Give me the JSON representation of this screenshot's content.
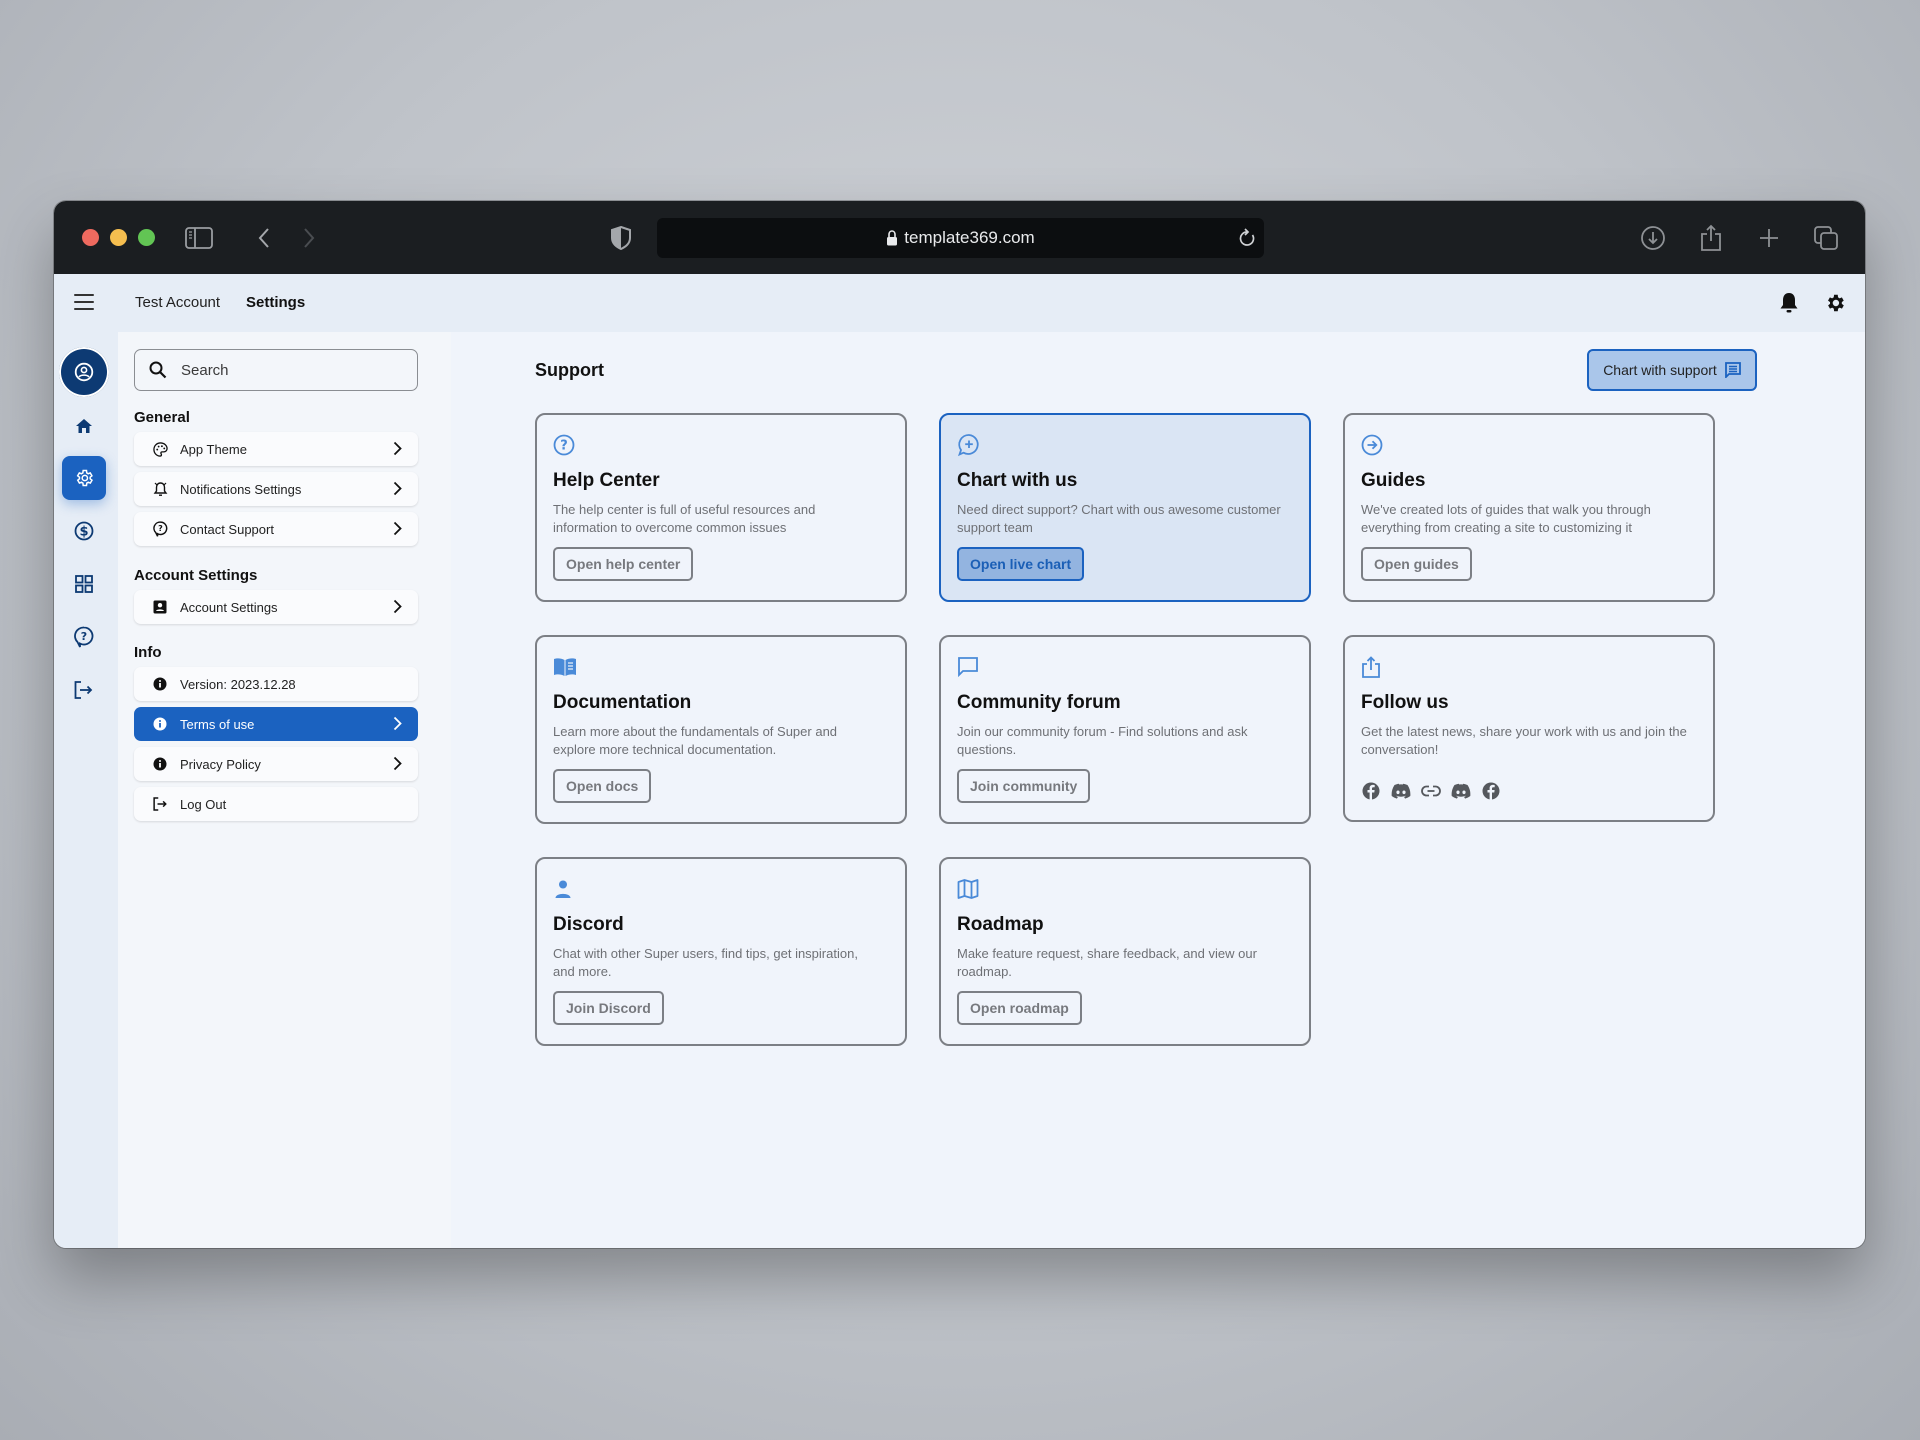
{
  "browser": {
    "url": "template369.com",
    "buttons": [
      "sidebar-toggle",
      "back",
      "forward",
      "download",
      "share",
      "new-tab",
      "tab-overview"
    ]
  },
  "header": {
    "breadcrumb": [
      "Test Account",
      "Settings"
    ],
    "icons": [
      "bell-icon",
      "gear-icon"
    ]
  },
  "rail": {
    "items": [
      {
        "icon": "home-icon",
        "active": false
      },
      {
        "icon": "gear-icon",
        "active": true
      },
      {
        "icon": "dollar-icon",
        "active": false
      },
      {
        "icon": "grid-icon",
        "active": false
      },
      {
        "icon": "help-icon",
        "active": false
      },
      {
        "icon": "logout-icon",
        "active": false
      }
    ]
  },
  "settings": {
    "search_placeholder": "Search",
    "sections": {
      "general": {
        "title": "General",
        "items": [
          {
            "label": "App Theme",
            "icon": "palette-icon"
          },
          {
            "label": "Notifications Settings",
            "icon": "bell-icon"
          },
          {
            "label": "Contact Support",
            "icon": "help-icon"
          }
        ]
      },
      "account": {
        "title": "Account Settings",
        "items": [
          {
            "label": "Account Settings",
            "icon": "contact-card-icon"
          }
        ]
      },
      "info": {
        "title": "Info",
        "items": [
          {
            "label": "Version: 2023.12.28",
            "icon": "info-icon"
          },
          {
            "label": "Terms of use",
            "icon": "info-icon",
            "active": true
          },
          {
            "label": "Privacy Policy",
            "icon": "info-icon"
          },
          {
            "label": "Log Out",
            "icon": "logout-icon"
          }
        ]
      }
    }
  },
  "main": {
    "title": "Support",
    "support_button": "Chart with support",
    "cards": [
      {
        "title": "Help Center",
        "desc": "The help center is full of useful resources and information to overcome common issues",
        "button": "Open help center",
        "icon": "help-circle-icon"
      },
      {
        "title": "Chart with us",
        "desc": "Need direct support? Chart with ous awesome customer support team",
        "button": "Open live chart",
        "icon": "chat-plus-icon",
        "highlight": true
      },
      {
        "title": "Guides",
        "desc": "We've created lots of guides that walk you through everything from creating a site to customizing it",
        "button": "Open guides",
        "icon": "arrow-circle-icon"
      },
      {
        "title": "Documentation",
        "desc": "Learn more about the fundamentals of Super and explore more technical documentation.",
        "button": "Open docs",
        "icon": "book-icon"
      },
      {
        "title": "Community forum",
        "desc": "Join our community forum - Find solutions and ask questions.",
        "button": "Join community",
        "icon": "chat-bubble-icon"
      },
      {
        "title": "Follow us",
        "desc": "Get the latest news, share your work with us and join the conversation!",
        "icon": "share-icon",
        "socials": [
          "facebook-icon",
          "discord-icon",
          "link-icon",
          "discord-icon",
          "facebook-icon"
        ]
      },
      {
        "title": "Discord",
        "desc": "Chat with other Super users, find tips, get inspiration, and more.",
        "button": "Join Discord",
        "icon": "person-icon"
      },
      {
        "title": "Roadmap",
        "desc": "Make feature request, share feedback, and view our roadmap.",
        "button": "Open roadmap",
        "icon": "map-icon"
      }
    ]
  },
  "colors": {
    "accent": "#1b62c0",
    "accent_light": "#aac6ea",
    "avatar_bg": "#0d3a73",
    "card_icon": "#4a8ad8",
    "chrome_bg": "#1b1e21"
  }
}
